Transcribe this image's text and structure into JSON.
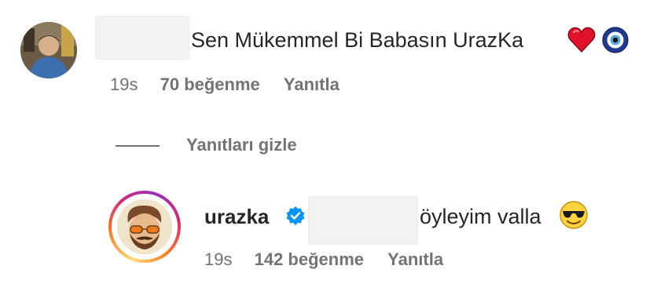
{
  "comment": {
    "text": "Sen Mükemmel Bi Babasın UrazKa",
    "emojis": [
      "red-heart",
      "nazar-amulet"
    ],
    "time": "19s",
    "likes": "70 beğenme",
    "reply_label": "Yanıtla"
  },
  "replies_toggle": {
    "label": "Yanıtları gizle"
  },
  "reply": {
    "username": "urazka",
    "verified": true,
    "text": "öyleyim valla",
    "emoji": "smiling-face-with-sunglasses",
    "time": "19s",
    "likes": "142 beğenme",
    "reply_label": "Yanıtla"
  },
  "colors": {
    "text": "#262626",
    "meta": "#737373",
    "verified": "#0095f6",
    "heart": "#e0112b",
    "nazar": "#1f3b8f"
  }
}
